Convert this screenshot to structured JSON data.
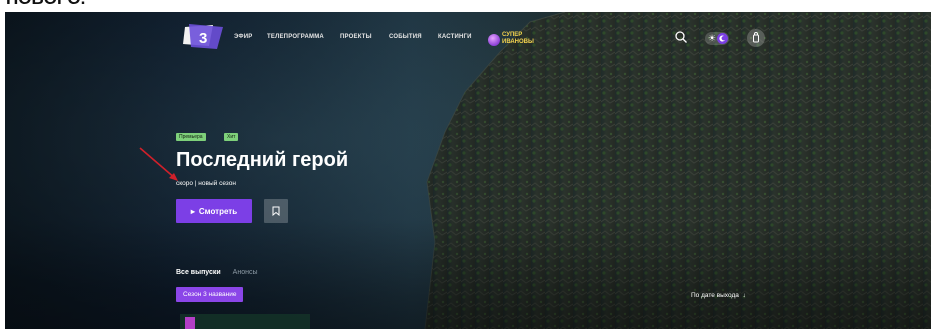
{
  "caption_fragment": "HOBOFO.",
  "nav": {
    "logo_text": "3",
    "items": [
      {
        "label": "ЭФИР"
      },
      {
        "label": "ТЕЛЕПРОГРАММА"
      },
      {
        "label": "ПРОЕКТЫ"
      },
      {
        "label": "СОБЫТИЯ"
      },
      {
        "label": "КАСТИНГИ"
      }
    ],
    "promo_line1": "СУПЕР",
    "promo_line2": "ИВАНОВЫ"
  },
  "hero": {
    "badges": [
      "Премьера",
      "Хит"
    ],
    "title": "Последний герой",
    "subtitle": "скоро | новый сезон",
    "watch_label": "Смотреть"
  },
  "episodes": {
    "tabs": [
      {
        "label": "Все выпуски",
        "active": true
      },
      {
        "label": "Анонсы",
        "active": false
      }
    ],
    "season_label": "Сезон 3 название",
    "sort_label": "По дате выхода"
  },
  "colors": {
    "accent": "#7c3fe6",
    "badge": "#7ed07a",
    "arrow": "#d0202a",
    "promo": "#f3d24d"
  },
  "icons": [
    "search-icon",
    "sun-icon",
    "moon-icon",
    "user-icon",
    "play-icon",
    "bookmark-icon",
    "arrow-down-icon"
  ]
}
